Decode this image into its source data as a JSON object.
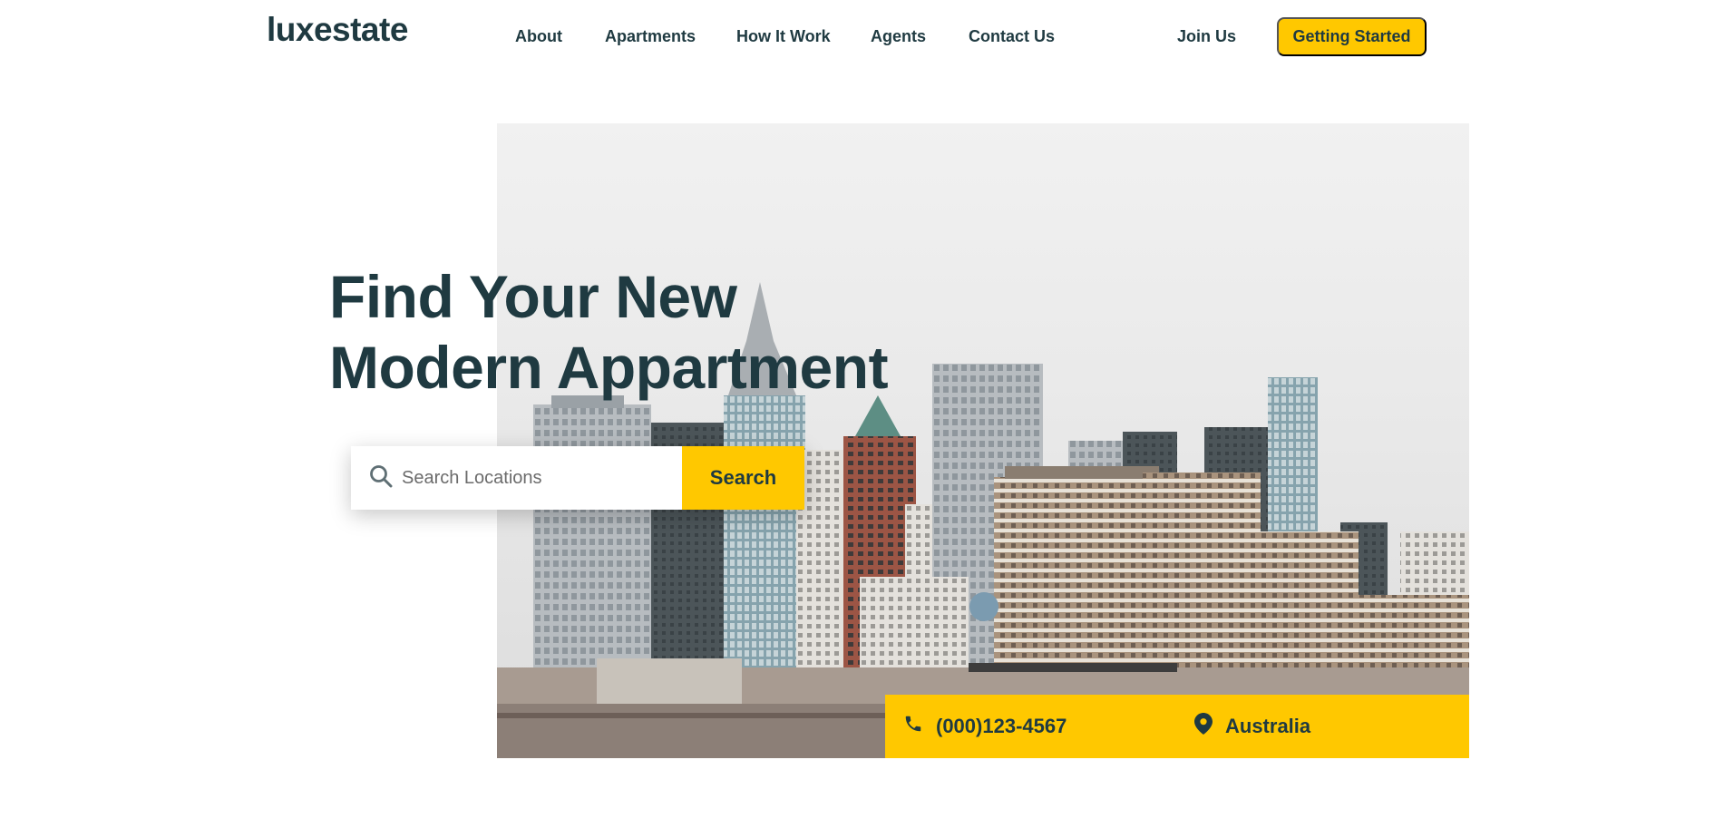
{
  "brand": {
    "logo": "luxestate"
  },
  "nav": {
    "items": [
      {
        "label": "About"
      },
      {
        "label": "Apartments"
      },
      {
        "label": "How It Work"
      },
      {
        "label": "Agents"
      },
      {
        "label": "Contact Us"
      }
    ],
    "join_label": "Join Us",
    "cta_label": "Getting Started"
  },
  "hero": {
    "headline_line1": "Find Your New",
    "headline_line2": "Modern Appartment",
    "search": {
      "placeholder": "Search Locations",
      "button_label": "Search"
    },
    "contact": {
      "phone": "(000)123-4567",
      "location": "Australia"
    }
  },
  "colors": {
    "accent": "#ffc800",
    "text": "#1f3a41",
    "background": "#ffffff"
  },
  "icons": {
    "search": "search-icon",
    "phone": "phone-icon",
    "location": "map-pin-icon"
  }
}
